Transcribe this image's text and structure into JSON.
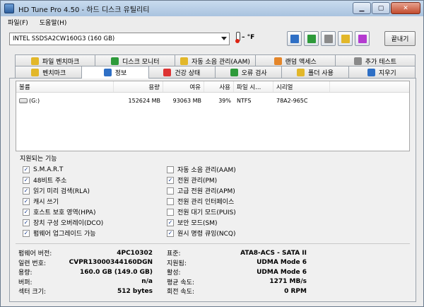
{
  "window": {
    "title": "HD Tune Pro 4.50 - 하드 디스크 유틸리티"
  },
  "menu": [
    {
      "label": "파일(F)"
    },
    {
      "label": "도움말(H)"
    }
  ],
  "toolbar": {
    "drive": "INTEL SSDSA2CW160G3      (160 GB)",
    "temperature": "– °F",
    "exit_label": "끝내기"
  },
  "tabs_row1": [
    {
      "label": "파일 벤치마크",
      "icon": "file-benchmark-icon"
    },
    {
      "label": "디스크 모니터",
      "icon": "disk-monitor-icon"
    },
    {
      "label": "자동 소음 관리(AAM)",
      "icon": "speaker-icon"
    },
    {
      "label": "랜덤 액세스",
      "icon": "random-access-icon"
    },
    {
      "label": "추가 테스트",
      "icon": "extra-tests-icon"
    }
  ],
  "tabs_row2": [
    {
      "label": "벤치마크",
      "icon": "benchmark-icon"
    },
    {
      "label": "정보",
      "icon": "info-icon",
      "active": true
    },
    {
      "label": "건강 상태",
      "icon": "health-cross-icon"
    },
    {
      "label": "오류 검사",
      "icon": "magnifier-icon"
    },
    {
      "label": "폴더 사용",
      "icon": "folder-icon"
    },
    {
      "label": "지우기",
      "icon": "erase-icon"
    }
  ],
  "partitions": {
    "columns": [
      "볼륨",
      "용량",
      "여유",
      "사용",
      "파일 시...",
      "시리얼"
    ],
    "rows": [
      [
        "(G:)",
        "152624 MB",
        "93063 MB",
        "39%",
        "NTFS",
        "78A2-965C"
      ]
    ]
  },
  "features": {
    "title": "지원되는 기능",
    "left": [
      {
        "label": "S.M.A.R.T",
        "checked": true
      },
      {
        "label": "48비트 주소",
        "checked": true
      },
      {
        "label": "읽기 미리 검색(RLA)",
        "checked": true
      },
      {
        "label": "캐시 쓰기",
        "checked": true
      },
      {
        "label": "호스트 보호 영역(HPA)",
        "checked": true
      },
      {
        "label": "장치 구성 오버레이(DCO)",
        "checked": true
      },
      {
        "label": "펌웨어 업그레이드 가능",
        "checked": true
      }
    ],
    "right": [
      {
        "label": "자동 소음 관리(AAM)",
        "checked": false
      },
      {
        "label": "전원 관리(PM)",
        "checked": true
      },
      {
        "label": "고급 전원 관리(APM)",
        "checked": false
      },
      {
        "label": "전원 관리 인터페이스",
        "checked": false
      },
      {
        "label": "전원 대기 모드(PUIS)",
        "checked": false
      },
      {
        "label": "보안 모드(SM)",
        "checked": true
      },
      {
        "label": "원시 명령 큐잉(NCQ)",
        "checked": true
      }
    ]
  },
  "info_left": [
    {
      "label": "펌웨어 버전:",
      "value": "4PC10302"
    },
    {
      "label": "일련 번호:",
      "value": "CVPR13000344160DGN"
    },
    {
      "label": "용량:",
      "value": "160.0 GB (149.0 GB)"
    },
    {
      "label": "버퍼:",
      "value": "n/a"
    },
    {
      "label": "섹터 크기:",
      "value": "512 bytes"
    }
  ],
  "info_right": [
    {
      "label": "표준:",
      "value": "ATA8-ACS - SATA II"
    },
    {
      "label": "지원됨:",
      "value": "UDMA Mode 6"
    },
    {
      "label": "활성:",
      "value": "UDMA Mode 6"
    },
    {
      "label": "평균 속도:",
      "value": "1271 MB/s"
    },
    {
      "label": "회전 속도:",
      "value": "0 RPM"
    }
  ]
}
